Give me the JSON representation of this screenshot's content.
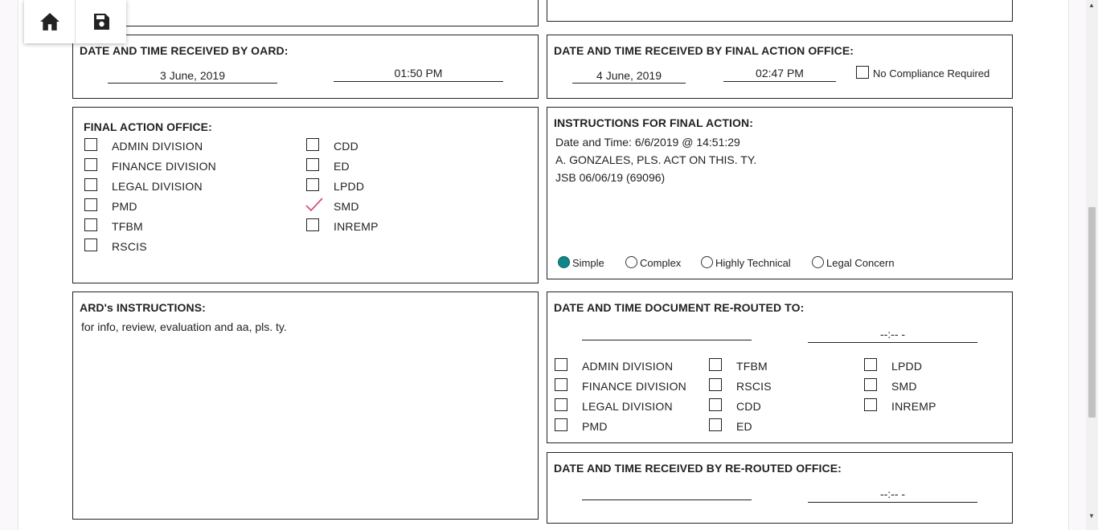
{
  "toolbar": {
    "home_icon": "home-icon",
    "save_icon": "save-icon"
  },
  "oard": {
    "title": "DATE AND TIME RECEIVED BY OARD:",
    "date": "3 June, 2019",
    "time": "01:50 PM"
  },
  "fao_received": {
    "title": "DATE AND TIME RECEIVED BY FINAL ACTION OFFICE:",
    "date": "4 June, 2019",
    "time": "02:47 PM",
    "no_compliance_label": "No Compliance Required",
    "no_compliance_checked": false
  },
  "final_action_office": {
    "title": "FINAL ACTION OFFICE:",
    "options": [
      {
        "label": "ADMIN DIVISION",
        "checked": false
      },
      {
        "label": "FINANCE DIVISION",
        "checked": false
      },
      {
        "label": "LEGAL DIVISION",
        "checked": false
      },
      {
        "label": "PMD",
        "checked": false
      },
      {
        "label": "TFBM",
        "checked": false
      },
      {
        "label": "RSCIS",
        "checked": false
      },
      {
        "label": "CDD",
        "checked": false
      },
      {
        "label": "ED",
        "checked": false
      },
      {
        "label": "LPDD",
        "checked": false
      },
      {
        "label": "SMD",
        "checked": true
      },
      {
        "label": "INREMP",
        "checked": false
      }
    ]
  },
  "instructions_final": {
    "title": "INSTRUCTIONS FOR FINAL ACTION:",
    "lines": [
      "Date and Time: 6/6/2019 @ 14:51:29",
      "A. GONZALES, PLS. ACT ON THIS. TY.",
      "JSB 06/06/19 (69096)"
    ],
    "complexity": [
      {
        "label": "Simple",
        "selected": true
      },
      {
        "label": "Complex",
        "selected": false
      },
      {
        "label": "Highly Technical",
        "selected": false
      },
      {
        "label": "Legal Concern",
        "selected": false
      }
    ]
  },
  "ard": {
    "title": "ARD's INSTRUCTIONS:",
    "text": "for info, review, evaluation and aa, pls. ty."
  },
  "rerouted": {
    "title": "DATE AND TIME DOCUMENT RE-ROUTED TO:",
    "date": "",
    "time": "--:-- -",
    "options": [
      {
        "label": "ADMIN DIVISION",
        "checked": false
      },
      {
        "label": "FINANCE DIVISION",
        "checked": false
      },
      {
        "label": "LEGAL DIVISION",
        "checked": false
      },
      {
        "label": "PMD",
        "checked": false
      },
      {
        "label": "TFBM",
        "checked": false
      },
      {
        "label": "RSCIS",
        "checked": false
      },
      {
        "label": "CDD",
        "checked": false
      },
      {
        "label": "ED",
        "checked": false
      },
      {
        "label": "LPDD",
        "checked": false
      },
      {
        "label": "SMD",
        "checked": false
      },
      {
        "label": "INREMP",
        "checked": false
      }
    ]
  },
  "rerouted_received": {
    "title": "DATE AND TIME RECEIVED BY RE-ROUTED OFFICE:",
    "date": "",
    "time": "--:-- -"
  },
  "colors": {
    "accent_check": "#d64f7f",
    "radio_selected": "#11868a"
  }
}
